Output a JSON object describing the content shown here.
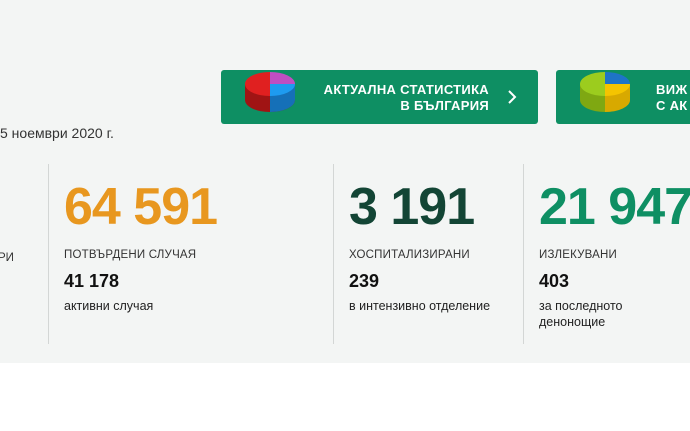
{
  "buttons": {
    "stats": {
      "line1": "АКТУАЛНА СТАТИСТИКА",
      "line2": "В БЪЛГАРИЯ"
    },
    "more": {
      "line1": "ВИЖ",
      "line2": "С АК"
    }
  },
  "date_text": "5 ноември 2020 г.",
  "cut_label": "РИ",
  "stats": [
    {
      "value": "64 591",
      "label": "ПОТВЪРДЕНИ СЛУЧАЯ",
      "sub_value": "41 178",
      "sub_caption": "активни случая",
      "color": "#e8971f"
    },
    {
      "value": "3 191",
      "label": "ХОСПИТАЛИЗИРАНИ",
      "sub_value": "239",
      "sub_caption": "в интензивно отделение",
      "color": "#134535"
    },
    {
      "value": "21 947",
      "label": "ИЗЛЕКУВАНИ",
      "sub_value": "403",
      "sub_caption": "за последното денонощие",
      "color": "#0e8f63"
    }
  ],
  "icons": {
    "stats": "pie-chart-icon",
    "more": "pie-chart-icon",
    "arrow": "chevron-right-icon"
  }
}
